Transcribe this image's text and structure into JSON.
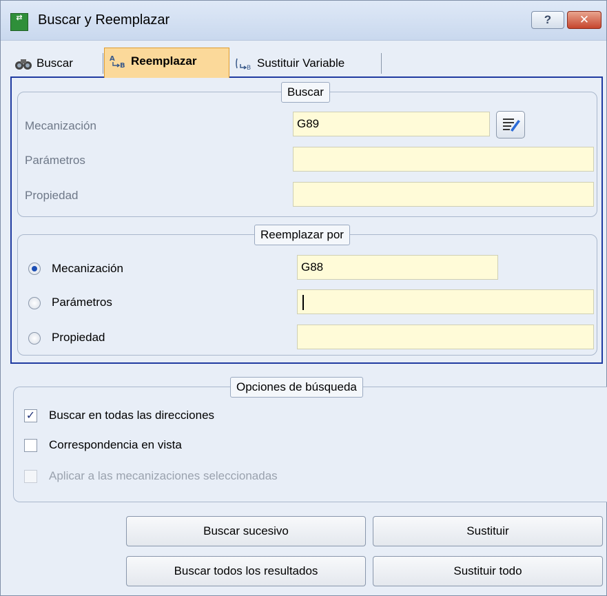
{
  "window": {
    "title": "Buscar y Reemplazar",
    "help_label": "?",
    "close_label": "✕"
  },
  "tabs": [
    {
      "label": "Buscar",
      "icon": "binoculars-icon",
      "active": false
    },
    {
      "label": "Reemplazar",
      "icon": "replace-icon",
      "active": true
    },
    {
      "label": "Sustituir Variable",
      "icon": "substitute-variable-icon",
      "active": false
    }
  ],
  "search_group": {
    "legend": "Buscar",
    "rows": [
      {
        "label": "Mecanización",
        "value": "G89"
      },
      {
        "label": "Parámetros",
        "value": ""
      },
      {
        "label": "Propiedad",
        "value": ""
      }
    ],
    "picker_icon": "edit-list-icon"
  },
  "replace_group": {
    "legend": "Reemplazar por",
    "rows": [
      {
        "label": "Mecanización",
        "value": "G88",
        "selected": true
      },
      {
        "label": "Parámetros",
        "value": "",
        "selected": false
      },
      {
        "label": "Propiedad",
        "value": "",
        "selected": false
      }
    ]
  },
  "options_group": {
    "legend": "Opciones de búsqueda",
    "items": [
      {
        "label": "Buscar en todas las direcciones",
        "checked": true,
        "enabled": true
      },
      {
        "label": "Correspondencia en vista",
        "checked": false,
        "enabled": true
      },
      {
        "label": "Aplicar a las mecanizaciones seleccionadas",
        "checked": false,
        "enabled": false
      }
    ]
  },
  "buttons": {
    "find_next": "Buscar sucesivo",
    "replace": "Sustituir",
    "find_all": "Buscar todos los resultados",
    "replace_all": "Sustituir todo"
  },
  "colors": {
    "accent_border": "#1f3aa0",
    "active_tab": "#fbd99a",
    "field_bg": "#fffbd8"
  }
}
